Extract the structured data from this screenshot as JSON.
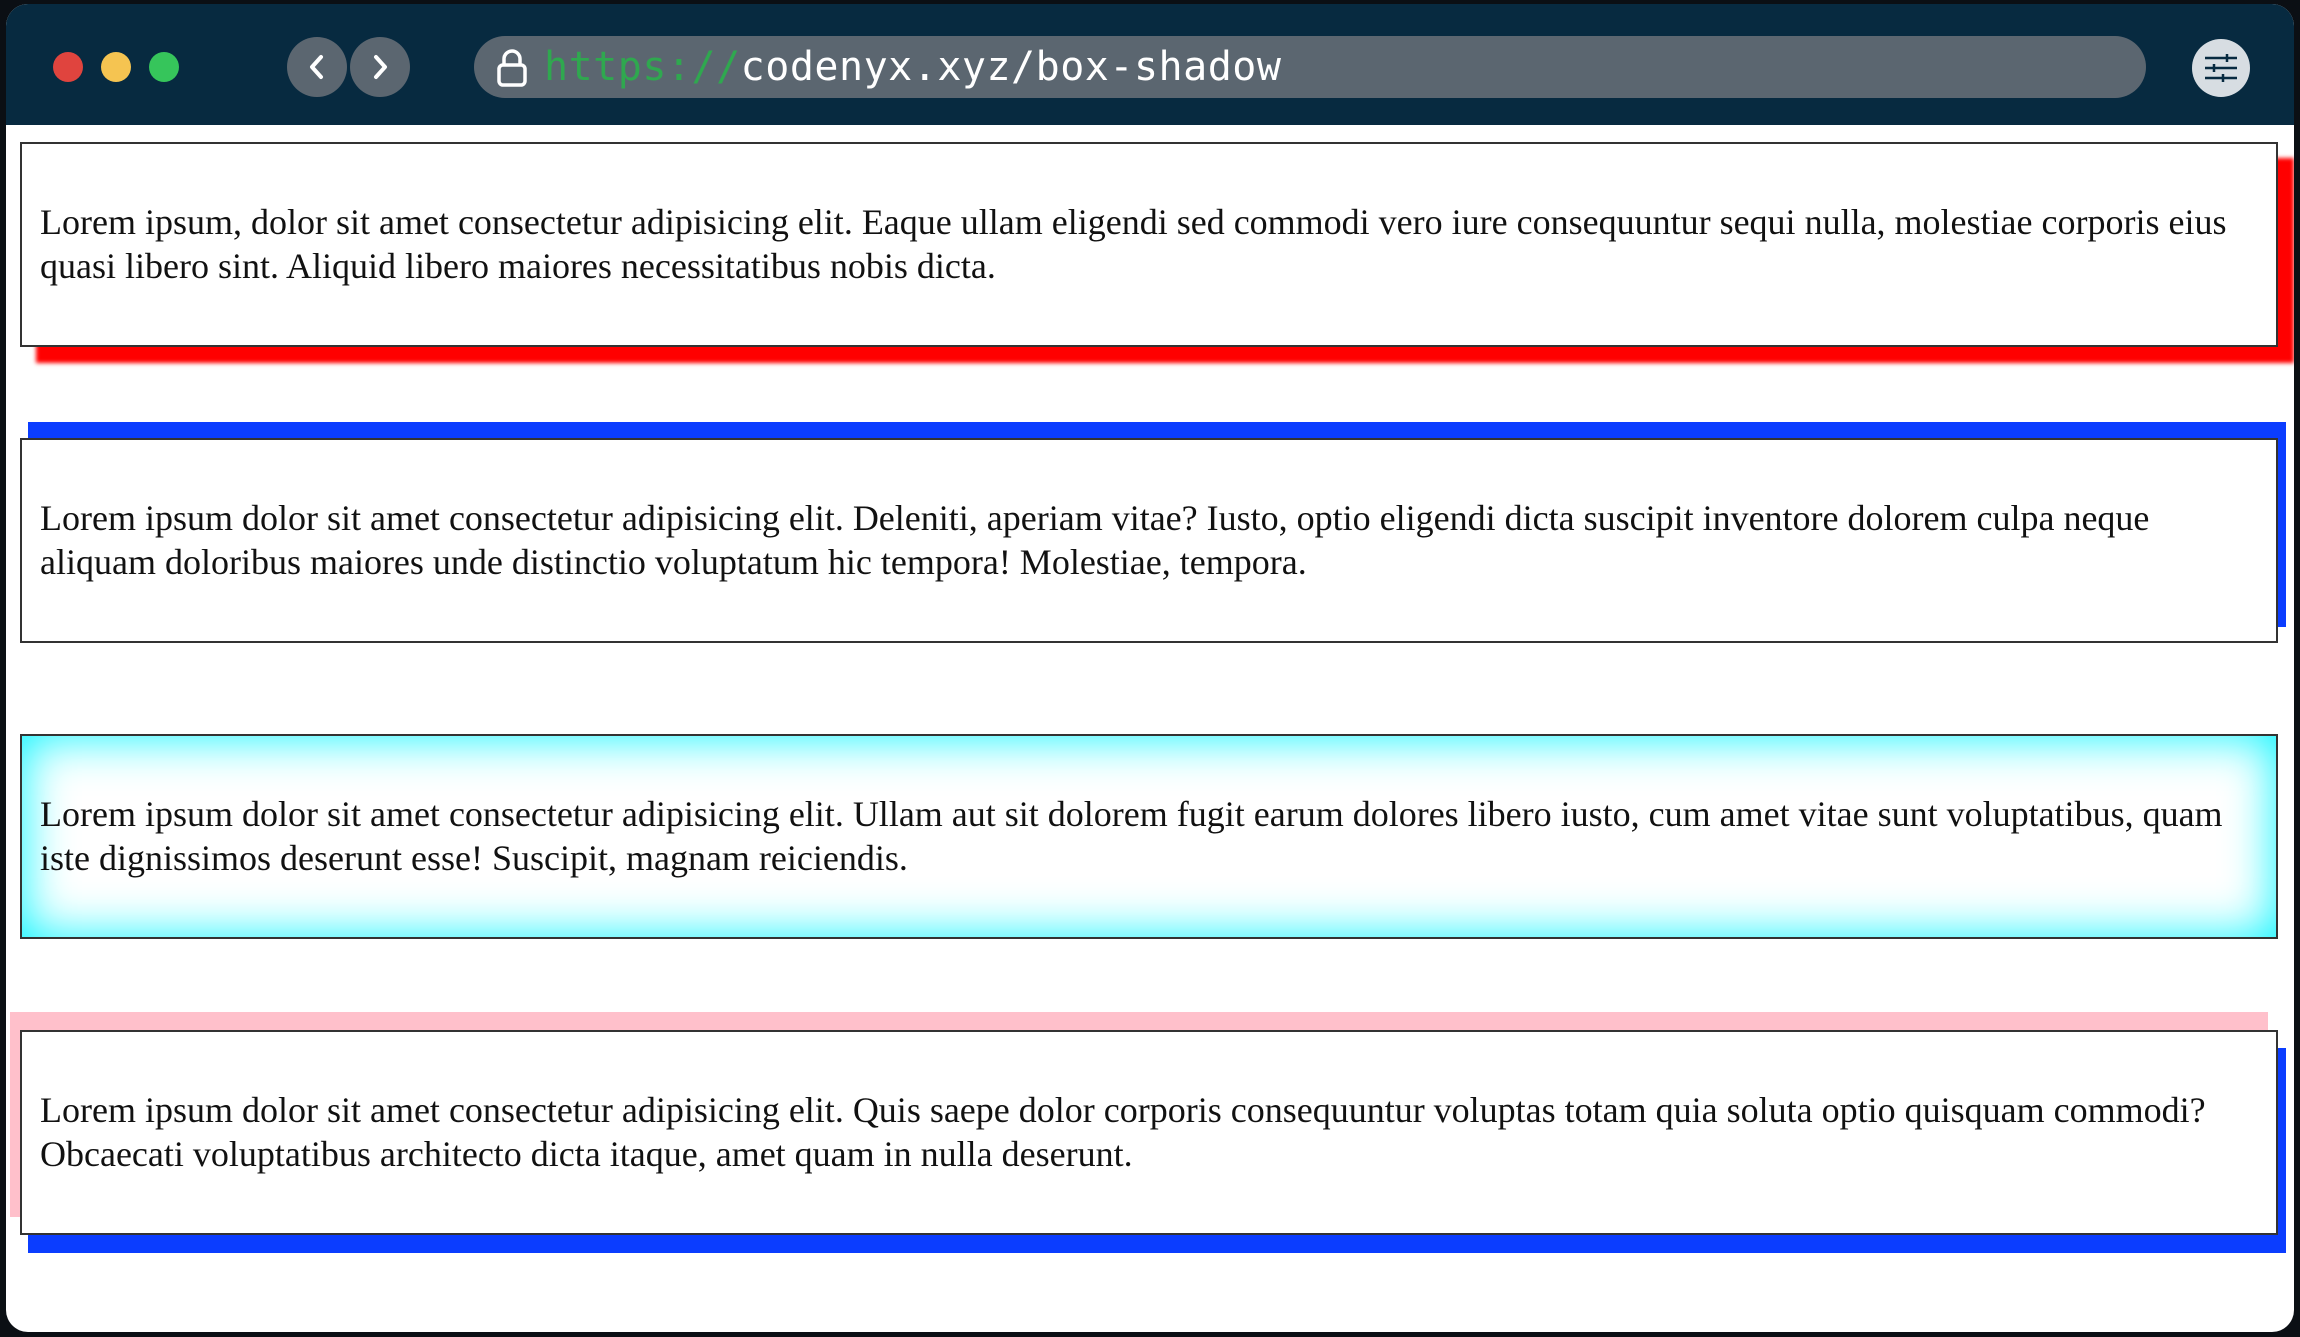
{
  "browser": {
    "url_protocol": "https://",
    "url_path": "codenyx.xyz/box-shadow",
    "icons": [
      "lock-icon",
      "chevron-left-icon",
      "chevron-right-icon",
      "sliders-icon"
    ],
    "traffic_lights": {
      "close": "#e0443e",
      "minimize": "#f5c451",
      "zoom": "#36c55b"
    }
  },
  "boxes": [
    {
      "text": "Lorem ipsum, dolor sit amet consectetur adipisicing elit. Eaque ullam eligendi sed commodi vero iure consequuntur sequi nulla, molestiae corporis eius quasi libero sint. Aliquid libero maiores necessitatibus nobis dicta.",
      "shadow_color": "#ff0000"
    },
    {
      "text": "Lorem ipsum dolor sit amet consectetur adipisicing elit. Deleniti, aperiam vitae? Iusto, optio eligendi dicta suscipit inventore dolorem culpa neque aliquam doloribus maiores unde distinctio voluptatum hic tempora! Molestiae, tempora.",
      "shadow_color": "#0b3dff"
    },
    {
      "text": "Lorem ipsum dolor sit amet consectetur adipisicing elit. Ullam aut sit dolorem fugit earum dolores libero iusto, cum amet vitae sunt voluptatibus, quam iste dignissimos deserunt esse! Suscipit, magnam reiciendis.",
      "shadow_color": "#00f5ff"
    },
    {
      "text": "Lorem ipsum dolor sit amet consectetur adipisicing elit. Quis saepe dolor corporis consequuntur voluptas totam quia soluta optio quisquam commodi? Obcaecati voluptatibus architecto dicta itaque, amet quam in nulla deserunt.",
      "shadow_color": "#ffc0cb"
    }
  ]
}
